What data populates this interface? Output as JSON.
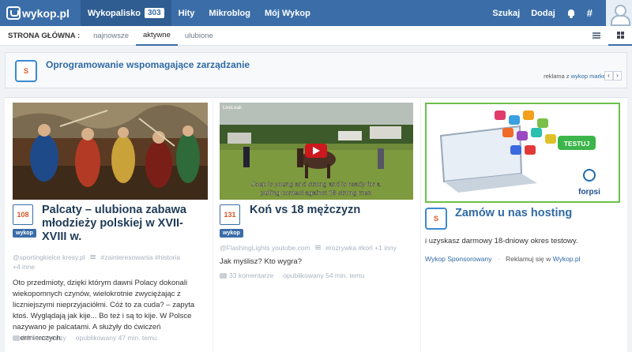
{
  "topbar": {
    "logo_text": "wykop.pl",
    "nav": [
      {
        "label": "Wykopalisko",
        "badge": "303"
      },
      {
        "label": "Hity"
      },
      {
        "label": "Mikroblog"
      },
      {
        "label": "Mój Wykop"
      }
    ],
    "right": {
      "search": "Szukaj",
      "add": "Dodaj",
      "hash": "#"
    }
  },
  "subbar": {
    "label": "STRONA GŁÓWNA :",
    "tabs": [
      "najnowsze",
      "aktywne",
      "ulubione"
    ],
    "active_tab": "aktywne"
  },
  "ad_banner": {
    "icon_text": "S",
    "title": "Oprogramowanie wspomagające zarządzanie",
    "meta_prefix": "reklama z",
    "meta_link": "wykop market",
    "prev": "‹",
    "next": "›"
  },
  "cards": [
    {
      "votes": "108",
      "wykop_label": "wykop",
      "title": "Palcaty – ulubiona zabawa młodzieży polskiej w XVII-XVIII w.",
      "author": "@sportingkielce",
      "domain": "kresy.pl",
      "tags": [
        "#zainteresowania",
        "#historia"
      ],
      "more_tags": "+4 inne",
      "description": "Oto przedmioty, dzięki którym dawni Polacy dokonali wiekopomnych czynów, wielokrotnie zwyciężając z liczniejszymi nieprzyjaciółmi. Cóż to za cuda? – zapyta ktoś. Wyglądają jak kije... Bo też i są to kije. W Polsce nazywano je palcatami. A służyły do ćwiczeń szermierczych.",
      "comments": "10 komentarzy",
      "published": "opublikowany 47 min. temu"
    },
    {
      "votes": "131",
      "wykop_label": "wykop",
      "title": "Koń vs 18 mężczyzn",
      "author": "@FlashingLights",
      "domain": "youtube.com",
      "tags": [
        "#rozrywka",
        "#koń"
      ],
      "more_tags": "+1 inny",
      "description": "Jak myślisz? Kto wygra?",
      "comments": "33 komentarze",
      "published": "opublikowany 54 min. temu",
      "video_caption_1": "Joep is young and strong and is ready for a",
      "video_caption_2": "pulling contest against 18 strong men",
      "video_watermark": "LiveLeak"
    },
    {
      "icon_text": "S",
      "ad_button": "TESTUJ",
      "ad_brand": "forpsi",
      "title": "Zamów u nas hosting",
      "description": "i uzyskasz darmowy 18-dniowy okres testowy.",
      "sponsor": "Wykop Sponsorowany",
      "advertise_prefix": "Reklamuj się w",
      "advertise_link": "Wykop.pl"
    }
  ]
}
